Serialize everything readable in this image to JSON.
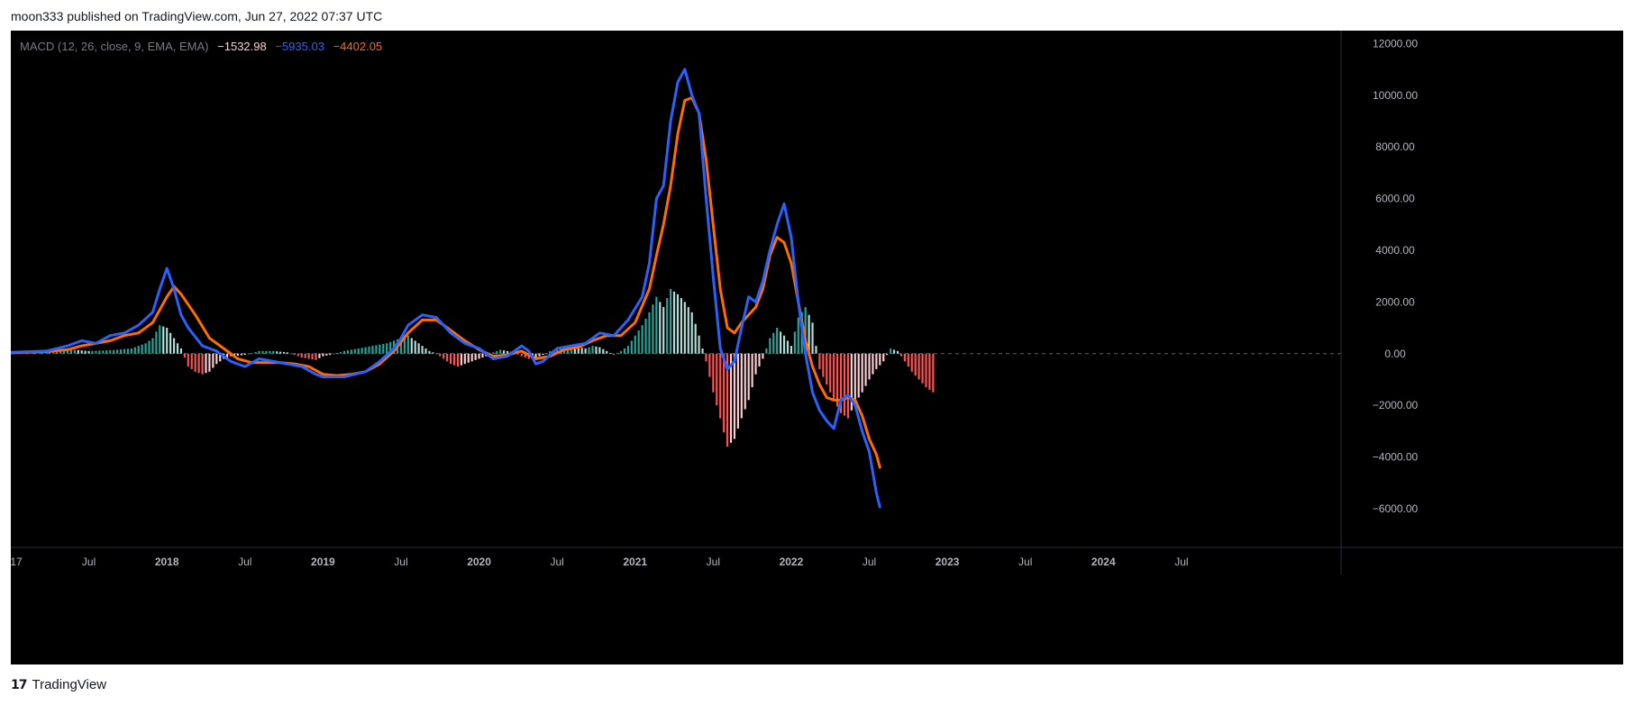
{
  "header": {
    "published": "moon333 published on TradingView.com, Jun 27, 2022 07:37 UTC"
  },
  "brand": {
    "logo_icon": "tradingview-logo-icon",
    "name": "TradingView"
  },
  "colors": {
    "background": "#000000",
    "macd_line": "#2962ff",
    "signal_line": "#ff6d00",
    "hist_pos_strong": "#26a69a",
    "hist_pos_weak": "#b2dfdb",
    "hist_neg_strong": "#ff5252",
    "hist_neg_weak": "#ffcdd2",
    "axis_text": "#b2b5be"
  },
  "legend": {
    "title": "MACD (12, 26, close, 9, EMA, EMA)",
    "histogram_value": "−1532.98",
    "macd_value": "−5935.03",
    "signal_value": "−4402.05"
  },
  "chart_data": {
    "type": "line",
    "title": "",
    "xlabel": "",
    "ylabel": "",
    "indicator": "MACD (12, 26, close, 9, EMA, EMA)",
    "x_unit": "weeks since Sep 2017 (approximate, chart start)",
    "xlim": [
      0,
      375
    ],
    "ylim": [
      -7500,
      12500
    ],
    "x_tick_labels": [
      "17",
      "Jul",
      "2018",
      "Jul",
      "2019",
      "Jul",
      "2020",
      "Jul",
      "2021",
      "Jul",
      "2022",
      "Jul",
      "2023",
      "Jul",
      "2024",
      "Jul"
    ],
    "x_ticks": [
      0,
      22,
      44,
      66,
      88,
      110,
      132,
      154,
      176,
      198,
      220,
      242,
      264,
      286,
      308,
      330
    ],
    "y_ticks": [
      -6000,
      -4000,
      -2000,
      0,
      2000,
      4000,
      6000,
      8000,
      10000,
      12000
    ],
    "y_tick_labels": [
      "−6000.00",
      "−4000.00",
      "−2000.00",
      "0.00",
      "2000.00",
      "4000.00",
      "6000.00",
      "8000.00",
      "10000.00",
      "12000.00"
    ],
    "zero_line": "dashed",
    "grid": false,
    "series": [
      {
        "key": "macd",
        "points": [
          [
            0,
            50
          ],
          [
            10,
            100
          ],
          [
            16,
            300
          ],
          [
            20,
            500
          ],
          [
            24,
            400
          ],
          [
            28,
            700
          ],
          [
            32,
            800
          ],
          [
            36,
            1100
          ],
          [
            40,
            1600
          ],
          [
            42,
            2500
          ],
          [
            44,
            3300
          ],
          [
            46,
            2500
          ],
          [
            48,
            1500
          ],
          [
            50,
            1000
          ],
          [
            54,
            300
          ],
          [
            58,
            100
          ],
          [
            62,
            -300
          ],
          [
            66,
            -500
          ],
          [
            70,
            -200
          ],
          [
            74,
            -300
          ],
          [
            78,
            -400
          ],
          [
            82,
            -500
          ],
          [
            86,
            -800
          ],
          [
            88,
            -900
          ],
          [
            94,
            -900
          ],
          [
            100,
            -700
          ],
          [
            104,
            -300
          ],
          [
            108,
            200
          ],
          [
            110,
            600
          ],
          [
            112,
            1100
          ],
          [
            116,
            1500
          ],
          [
            120,
            1400
          ],
          [
            124,
            800
          ],
          [
            128,
            400
          ],
          [
            132,
            200
          ],
          [
            136,
            -200
          ],
          [
            140,
            -100
          ],
          [
            144,
            300
          ],
          [
            146,
            100
          ],
          [
            148,
            -400
          ],
          [
            150,
            -300
          ],
          [
            154,
            200
          ],
          [
            158,
            300
          ],
          [
            162,
            400
          ],
          [
            166,
            800
          ],
          [
            170,
            700
          ],
          [
            174,
            1300
          ],
          [
            178,
            2200
          ],
          [
            180,
            3500
          ],
          [
            182,
            6000
          ],
          [
            184,
            6500
          ],
          [
            186,
            9000
          ],
          [
            188,
            10500
          ],
          [
            190,
            11000
          ],
          [
            192,
            10000
          ],
          [
            194,
            9300
          ],
          [
            196,
            6000
          ],
          [
            198,
            3000
          ],
          [
            200,
            200
          ],
          [
            202,
            -600
          ],
          [
            204,
            -300
          ],
          [
            206,
            1000
          ],
          [
            208,
            2200
          ],
          [
            210,
            2000
          ],
          [
            212,
            2800
          ],
          [
            214,
            4000
          ],
          [
            216,
            5000
          ],
          [
            218,
            5800
          ],
          [
            220,
            4500
          ],
          [
            222,
            2000
          ],
          [
            224,
            0
          ],
          [
            226,
            -1500
          ],
          [
            228,
            -2200
          ],
          [
            230,
            -2600
          ],
          [
            232,
            -2900
          ],
          [
            234,
            -1800
          ],
          [
            236,
            -1600
          ],
          [
            238,
            -2000
          ],
          [
            240,
            -3000
          ],
          [
            242,
            -3800
          ],
          [
            244,
            -5400
          ],
          [
            245,
            -5935
          ]
        ]
      },
      {
        "key": "signal",
        "points": [
          [
            0,
            30
          ],
          [
            10,
            80
          ],
          [
            16,
            150
          ],
          [
            20,
            300
          ],
          [
            24,
            400
          ],
          [
            28,
            500
          ],
          [
            32,
            700
          ],
          [
            36,
            800
          ],
          [
            40,
            1200
          ],
          [
            44,
            2200
          ],
          [
            46,
            2600
          ],
          [
            48,
            2300
          ],
          [
            52,
            1500
          ],
          [
            56,
            600
          ],
          [
            60,
            200
          ],
          [
            64,
            -200
          ],
          [
            68,
            -350
          ],
          [
            72,
            -350
          ],
          [
            76,
            -350
          ],
          [
            80,
            -400
          ],
          [
            84,
            -500
          ],
          [
            88,
            -800
          ],
          [
            92,
            -850
          ],
          [
            96,
            -800
          ],
          [
            100,
            -700
          ],
          [
            104,
            -400
          ],
          [
            108,
            100
          ],
          [
            112,
            800
          ],
          [
            116,
            1300
          ],
          [
            120,
            1300
          ],
          [
            124,
            900
          ],
          [
            128,
            500
          ],
          [
            132,
            150
          ],
          [
            136,
            -100
          ],
          [
            140,
            -50
          ],
          [
            144,
            100
          ],
          [
            148,
            -200
          ],
          [
            152,
            -100
          ],
          [
            156,
            150
          ],
          [
            160,
            250
          ],
          [
            164,
            500
          ],
          [
            168,
            700
          ],
          [
            172,
            700
          ],
          [
            176,
            1200
          ],
          [
            180,
            2500
          ],
          [
            182,
            3800
          ],
          [
            184,
            5000
          ],
          [
            186,
            6500
          ],
          [
            188,
            8500
          ],
          [
            190,
            9800
          ],
          [
            192,
            9900
          ],
          [
            194,
            9300
          ],
          [
            196,
            7500
          ],
          [
            198,
            5000
          ],
          [
            200,
            2500
          ],
          [
            202,
            1000
          ],
          [
            204,
            800
          ],
          [
            206,
            1200
          ],
          [
            208,
            1500
          ],
          [
            210,
            1800
          ],
          [
            212,
            2500
          ],
          [
            214,
            3800
          ],
          [
            216,
            4500
          ],
          [
            218,
            4300
          ],
          [
            220,
            3500
          ],
          [
            222,
            2000
          ],
          [
            224,
            500
          ],
          [
            226,
            -500
          ],
          [
            228,
            -1200
          ],
          [
            230,
            -1700
          ],
          [
            232,
            -1800
          ],
          [
            234,
            -1800
          ],
          [
            236,
            -1700
          ],
          [
            238,
            -1800
          ],
          [
            240,
            -2400
          ],
          [
            242,
            -3300
          ],
          [
            244,
            -3900
          ],
          [
            245,
            -4402
          ]
        ]
      },
      {
        "key": "histogram",
        "type": "bar",
        "points": [
          [
            0,
            10
          ],
          [
            6,
            20
          ],
          [
            10,
            40
          ],
          [
            14,
            80
          ],
          [
            18,
            150
          ],
          [
            22,
            100
          ],
          [
            26,
            120
          ],
          [
            30,
            150
          ],
          [
            34,
            200
          ],
          [
            38,
            400
          ],
          [
            40,
            600
          ],
          [
            42,
            1100
          ],
          [
            44,
            1000
          ],
          [
            46,
            600
          ],
          [
            48,
            200
          ],
          [
            50,
            -500
          ],
          [
            52,
            -700
          ],
          [
            54,
            -800
          ],
          [
            56,
            -700
          ],
          [
            58,
            -400
          ],
          [
            60,
            -200
          ],
          [
            62,
            -100
          ],
          [
            66,
            -50
          ],
          [
            70,
            100
          ],
          [
            74,
            100
          ],
          [
            78,
            50
          ],
          [
            82,
            -150
          ],
          [
            86,
            -250
          ],
          [
            88,
            -100
          ],
          [
            90,
            -50
          ],
          [
            94,
            100
          ],
          [
            98,
            200
          ],
          [
            102,
            300
          ],
          [
            106,
            400
          ],
          [
            108,
            500
          ],
          [
            110,
            600
          ],
          [
            112,
            700
          ],
          [
            114,
            500
          ],
          [
            116,
            300
          ],
          [
            118,
            100
          ],
          [
            120,
            0
          ],
          [
            122,
            -200
          ],
          [
            124,
            -400
          ],
          [
            126,
            -500
          ],
          [
            128,
            -400
          ],
          [
            130,
            -300
          ],
          [
            132,
            -200
          ],
          [
            134,
            -100
          ],
          [
            136,
            50
          ],
          [
            138,
            150
          ],
          [
            140,
            100
          ],
          [
            142,
            50
          ],
          [
            144,
            -100
          ],
          [
            146,
            -200
          ],
          [
            148,
            -150
          ],
          [
            150,
            -50
          ],
          [
            152,
            100
          ],
          [
            154,
            200
          ],
          [
            156,
            250
          ],
          [
            158,
            300
          ],
          [
            160,
            250
          ],
          [
            162,
            200
          ],
          [
            164,
            300
          ],
          [
            166,
            250
          ],
          [
            168,
            100
          ],
          [
            170,
            -50
          ],
          [
            172,
            100
          ],
          [
            174,
            300
          ],
          [
            176,
            700
          ],
          [
            178,
            1100
          ],
          [
            180,
            1600
          ],
          [
            182,
            2200
          ],
          [
            184,
            1800
          ],
          [
            186,
            2500
          ],
          [
            188,
            2300
          ],
          [
            190,
            2000
          ],
          [
            192,
            1600
          ],
          [
            194,
            700
          ],
          [
            196,
            -300
          ],
          [
            198,
            -1500
          ],
          [
            200,
            -2500
          ],
          [
            202,
            -3600
          ],
          [
            204,
            -3300
          ],
          [
            206,
            -2500
          ],
          [
            208,
            -1800
          ],
          [
            210,
            -800
          ],
          [
            212,
            -200
          ],
          [
            214,
            600
          ],
          [
            216,
            1000
          ],
          [
            218,
            700
          ],
          [
            220,
            300
          ],
          [
            222,
            1400
          ],
          [
            224,
            1800
          ],
          [
            226,
            1200
          ],
          [
            228,
            -600
          ],
          [
            230,
            -1200
          ],
          [
            232,
            -1800
          ],
          [
            234,
            -2300
          ],
          [
            236,
            -2500
          ],
          [
            238,
            -1900
          ],
          [
            240,
            -1500
          ],
          [
            242,
            -1000
          ],
          [
            244,
            -600
          ],
          [
            246,
            -300
          ],
          [
            248,
            200
          ],
          [
            250,
            100
          ],
          [
            252,
            -300
          ],
          [
            254,
            -700
          ],
          [
            256,
            -1000
          ],
          [
            258,
            -1300
          ],
          [
            260,
            -1500
          ]
        ]
      }
    ]
  }
}
